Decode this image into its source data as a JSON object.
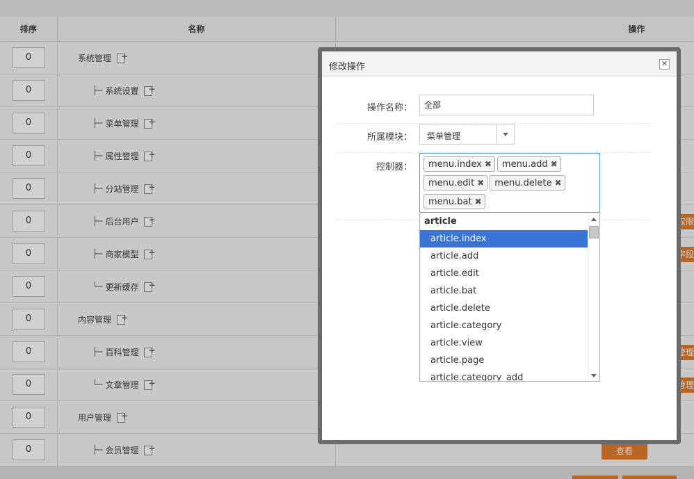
{
  "table": {
    "headers": {
      "sort": "排序",
      "name": "名称",
      "ops": "操作"
    },
    "rows": [
      {
        "sort": "0",
        "prefix": "",
        "name": "系统管理",
        "level": 0
      },
      {
        "sort": "0",
        "prefix": "├─",
        "name": "系统设置",
        "level": 1
      },
      {
        "sort": "0",
        "prefix": "├─",
        "name": "菜单管理",
        "level": 1
      },
      {
        "sort": "0",
        "prefix": "├─",
        "name": "属性管理",
        "level": 1
      },
      {
        "sort": "0",
        "prefix": "├─",
        "name": "分站管理",
        "level": 1
      },
      {
        "sort": "0",
        "prefix": "├─",
        "name": "后台用户",
        "level": 1
      },
      {
        "sort": "0",
        "prefix": "├─",
        "name": "商家模型",
        "level": 1
      },
      {
        "sort": "0",
        "prefix": "└─",
        "name": "更新缓存",
        "level": 1
      },
      {
        "sort": "0",
        "prefix": "",
        "name": "内容管理",
        "level": 0
      },
      {
        "sort": "0",
        "prefix": "├─",
        "name": "百科管理",
        "level": 1
      },
      {
        "sort": "0",
        "prefix": "└─",
        "name": "文章管理",
        "level": 1
      },
      {
        "sort": "0",
        "prefix": "",
        "name": "用户管理",
        "level": 0
      },
      {
        "sort": "0",
        "prefix": "├─",
        "name": "会员管理",
        "level": 1
      }
    ],
    "side_buttons": [
      "权限",
      "字段",
      "管理",
      "管理"
    ],
    "view_button": "查看"
  },
  "dialog": {
    "title": "修改操作",
    "close": "✕",
    "fields": {
      "name_label": "操作名称：",
      "name_value": "全部",
      "module_label": "所属模块：",
      "module_value": "菜单管理",
      "controller_label": "控制器："
    },
    "chips": [
      "menu.index",
      "menu.add",
      "menu.edit",
      "menu.delete",
      "menu.bat"
    ],
    "chip_remove": "✖",
    "dropdown": {
      "group": "article",
      "items": [
        "article.index",
        "article.add",
        "article.edit",
        "article.bat",
        "article.delete",
        "article.category",
        "article.view",
        "article.page",
        "article.category_add"
      ],
      "highlighted": "article.index"
    }
  },
  "colors": {
    "accent_orange": "#e07d2f",
    "highlight_blue": "#3875d7",
    "focus_border": "#5897fb"
  }
}
